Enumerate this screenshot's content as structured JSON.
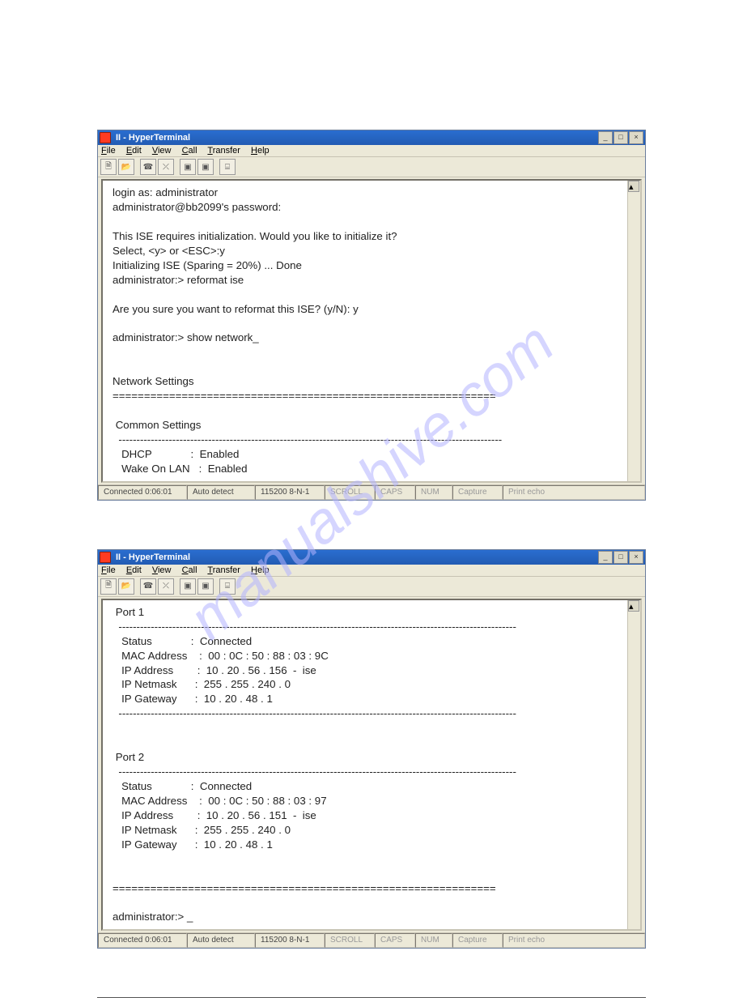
{
  "watermark": "manualshive.com",
  "window1": {
    "title": "II - HyperTerminal",
    "menu": [
      "File",
      "Edit",
      "View",
      "Call",
      "Transfer",
      "Help"
    ],
    "terminal_pre": "login as: administrator\nadministrator@bb2099's password:\n\nThis ISE requires initialization. Would you like to initialize it?\nSelect, <y> or <ESC>:y\nInitializing ISE (Sparing = 20%) ... Done\nadministrator:> reformat ise\n\nAre you sure you want to reformat this ISE? (y/N): y\n\nadministrator:> show network_\n\n\nNetwork Settings\n=============================================================\n\n Common Settings\n  -----------------------------------------------------------------------------------------------------------\n   DHCP             :  Enabled\n   Wake On LAN   :  Enabled",
    "status": {
      "connected": "Connected 0:06:01",
      "auto": "Auto detect",
      "cfg": "115200 8-N-1",
      "scroll": "SCROLL",
      "caps": "CAPS",
      "num": "NUM",
      "capture": "Capture",
      "print": "Print echo"
    }
  },
  "window2": {
    "title": "II - HyperTerminal",
    "menu": [
      "File",
      "Edit",
      "View",
      "Call",
      "Transfer",
      "Help"
    ],
    "terminal_pre": " Port 1\n  ---------------------------------------------------------------------------------------------------------------\n   Status             :  Connected\n   MAC Address    :  00 : 0C : 50 : 88 : 03 : 9C\n   IP Address        :  10 . 20 . 56 . 156  -  ise\n   IP Netmask      :  255 . 255 . 240 . 0\n   IP Gateway      :  10 . 20 . 48 . 1\n  ---------------------------------------------------------------------------------------------------------------\n\n\n Port 2\n  ---------------------------------------------------------------------------------------------------------------\n   Status             :  Connected\n   MAC Address    :  00 : 0C : 50 : 88 : 03 : 97\n   IP Address        :  10 . 20 . 56 . 151  -  ise\n   IP Netmask      :  255 . 255 . 240 . 0\n   IP Gateway      :  10 . 20 . 48 . 1\n\n\n=============================================================\n\nadministrator:> _",
    "status": {
      "connected": "Connected 0:06:01",
      "auto": "Auto detect",
      "cfg": "115200 8-N-1",
      "scroll": "SCROLL",
      "caps": "CAPS",
      "num": "NUM",
      "capture": "Capture",
      "print": "Print echo"
    }
  }
}
